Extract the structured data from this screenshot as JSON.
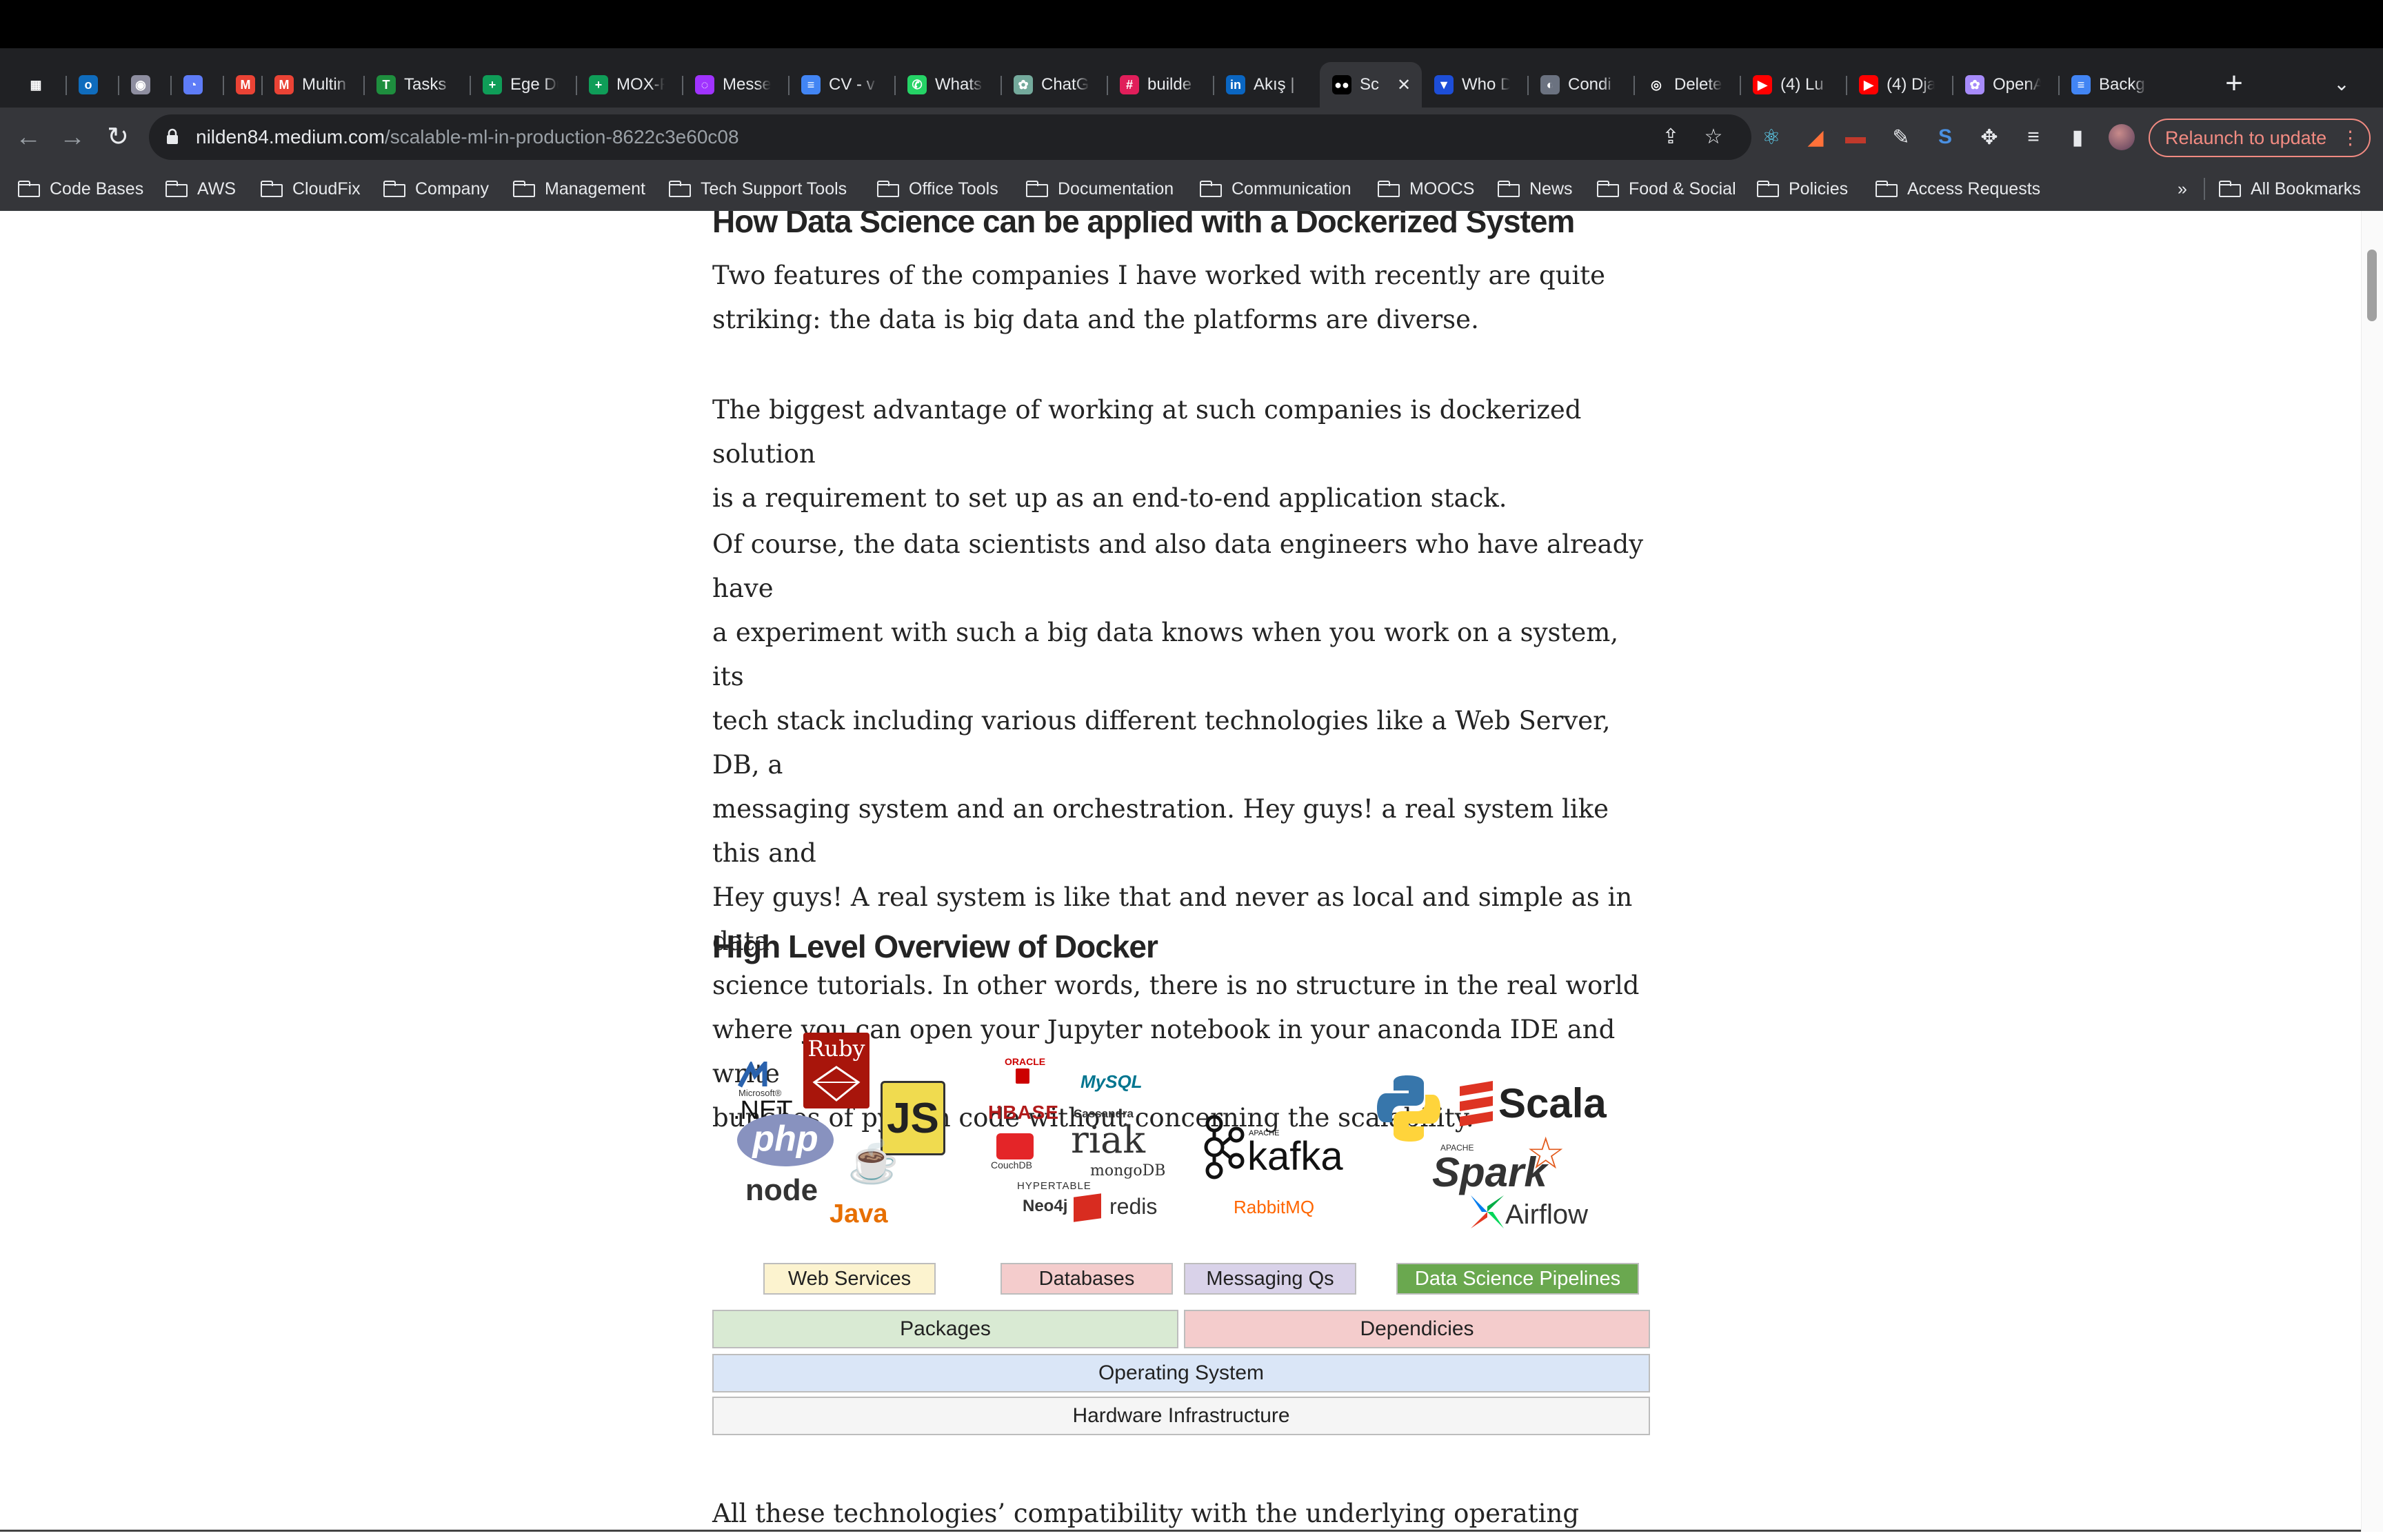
{
  "browser": {
    "tabs": [
      {
        "title": "",
        "icon": "workspace-icon",
        "color": "#ffffff"
      },
      {
        "title": "",
        "icon": "outlook-icon",
        "color": "#0f6cbd"
      },
      {
        "title": "",
        "icon": "extension-icon",
        "color": "#8e8ea0"
      },
      {
        "title": "",
        "icon": "clockify-icon",
        "color": "#5e7cf7"
      },
      {
        "title": "",
        "icon": "gmail-icon",
        "color": "#ea4335"
      },
      {
        "title": "Multin",
        "icon": "gmail-icon",
        "color": "#ea4335"
      },
      {
        "title": "Tasks",
        "icon": "tasks-icon",
        "color": "#1e8e3e"
      },
      {
        "title": "Ege Du",
        "icon": "sheets-icon",
        "color": "#0f9d58"
      },
      {
        "title": "MOX-F",
        "icon": "sheets-icon",
        "color": "#0f9d58"
      },
      {
        "title": "Messe",
        "icon": "messenger-icon",
        "color": "#a033ff"
      },
      {
        "title": "CV - v",
        "icon": "docs-icon",
        "color": "#4285f4"
      },
      {
        "title": "Whats",
        "icon": "whatsapp-icon",
        "color": "#25d366"
      },
      {
        "title": "ChatG",
        "icon": "chatgpt-icon",
        "color": "#74aa9c"
      },
      {
        "title": "builde",
        "icon": "slack-icon",
        "color": "#e01e5a"
      },
      {
        "title": "Akış |",
        "icon": "linkedin-icon",
        "color": "#0a66c2"
      },
      {
        "title": "Sc",
        "icon": "medium-icon",
        "color": "#000000",
        "active": true
      },
      {
        "title": "Who D",
        "icon": "vercel-icon",
        "color": "#1d4ed8"
      },
      {
        "title": "Condi",
        "icon": "condi-icon",
        "color": "#6b7280"
      },
      {
        "title": "Delete",
        "icon": "github-icon",
        "color": "#ffffff"
      },
      {
        "title": "(4) Lu",
        "icon": "youtube-icon",
        "color": "#ff0000"
      },
      {
        "title": "(4) Dja",
        "icon": "youtube-icon",
        "color": "#ff0000"
      },
      {
        "title": "OpenA",
        "icon": "openai-icon",
        "color": "#a78bfa"
      },
      {
        "title": "Backg",
        "icon": "docs-icon",
        "color": "#4285f4"
      }
    ],
    "url_host": "nilden84.medium.com",
    "url_path": "/scalable-ml-in-production-8622c3e60c08",
    "relaunch_label": "Relaunch to update",
    "bookmarks": [
      "Code Bases",
      "AWS",
      "CloudFix",
      "Company",
      "Management",
      "Tech Support Tools",
      "Office Tools",
      "Documentation",
      "Communication",
      "MOOCS",
      "News",
      "Food & Social",
      "Policies",
      "Access Requests"
    ],
    "bookmarks_overflow": "»",
    "all_bookmarks": "All Bookmarks"
  },
  "article": {
    "heading1": "How Data Science can be applied with a Dockerized System",
    "p1": "Two features of the companies I have worked with recently are quite\nstriking: the data is big data and the platforms are diverse.",
    "p2": "The biggest advantage of working at such companies is dockerized solution\nis a requirement to set up as an end-to-end application stack.",
    "p3": "Of course, the data scientists and also data engineers who have already have\na experiment with such a big data knows when you work on a system, its\ntech stack including various different technologies like a Web Server, DB, a\nmessaging system and an orchestration. Hey guys! a real system like this and\nHey guys! A real system is like that and never as local and simple as in data\nscience tutorials. In other words, there is no structure in the real world\nwhere you can open your Jupyter notebook in your anaconda IDE and write\nbunches of python code without concerning the scalability.",
    "heading2": "High Level Overview of Docker",
    "p4": "All these technologies’ compatibility with the underlying operating system is"
  },
  "diagram": {
    "categories": [
      {
        "label": "Web Services",
        "color": "#fcf3cf"
      },
      {
        "label": "Databases",
        "color": "#f4cccc"
      },
      {
        "label": "Messaging Qs",
        "color": "#d9d2e9"
      },
      {
        "label": "Data Science Pipelines",
        "color": "#6aa84f"
      }
    ],
    "layers": [
      {
        "label": "Packages",
        "color": "#d9ead3"
      },
      {
        "label": "Dependicies",
        "color": "#f4cccc"
      },
      {
        "label": "Operating System",
        "color": "#dae6f7"
      },
      {
        "label": "Hardware Infrastructure",
        "color": "#f5f5f5"
      }
    ],
    "logos": {
      "net_small": "Microsoft®",
      "net": ".NET",
      "ruby": "Ruby",
      "js": "JS",
      "php": "php",
      "node": "node",
      "java": "Java",
      "oracle": "ORACLE",
      "mysql": "MySQL",
      "hbase": "HBASE",
      "cassandra": "Cassandra",
      "couchdb": "CouchDB",
      "riak": "riak",
      "mongodb": "mongoDB",
      "hypertable": "HYPERTABLE",
      "neo4j": "Neo4j",
      "redis": "redis",
      "kafka": "kafka",
      "apache": "APACHE",
      "rabbitmq": "RabbitMQ",
      "scala": "Scala",
      "spark": "Spark",
      "airflow": "Airflow"
    }
  }
}
